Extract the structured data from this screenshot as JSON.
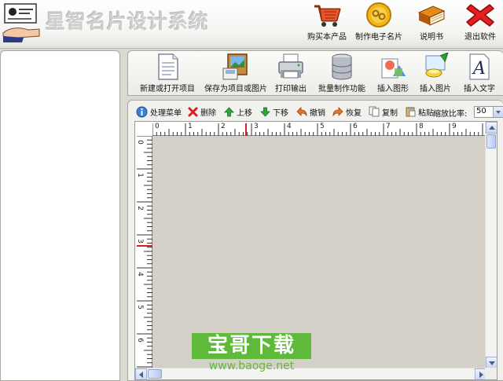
{
  "app": {
    "title": "星智名片设计系统"
  },
  "header": {
    "buttons": [
      {
        "label": "购买本产品",
        "icon": "shopping-cart-icon"
      },
      {
        "label": "制作电子名片",
        "icon": "gold-coin-icon"
      },
      {
        "label": "说明书",
        "icon": "book-icon"
      },
      {
        "label": "退出软件",
        "icon": "red-x-icon"
      }
    ]
  },
  "toolbar": {
    "buttons": [
      {
        "label": "新建或打开项目",
        "icon": "document-icon"
      },
      {
        "label": "保存为项目或图片",
        "icon": "save-picture-icon"
      },
      {
        "label": "打印输出",
        "icon": "printer-icon"
      },
      {
        "label": "批量制作功能",
        "icon": "database-icon"
      },
      {
        "label": "插入图形",
        "icon": "shapes-icon"
      },
      {
        "label": "插入图片",
        "icon": "paint-icon"
      },
      {
        "label": "插入文字",
        "icon": "text-a-icon"
      }
    ]
  },
  "edit_bar": {
    "items": [
      {
        "label": "处理菜单",
        "icon": "menu-globe-icon"
      },
      {
        "label": "删除",
        "icon": "delete-x-icon"
      },
      {
        "label": "上移",
        "icon": "up-arrow-icon"
      },
      {
        "label": "下移",
        "icon": "down-arrow-icon"
      },
      {
        "label": "撤销",
        "icon": "undo-icon"
      },
      {
        "label": "恢复",
        "icon": "redo-icon"
      },
      {
        "label": "复制",
        "icon": "copy-icon"
      },
      {
        "label": "粘贴",
        "icon": "paste-icon"
      }
    ],
    "zoom_label": "缩放比率:",
    "zoom_value": "50",
    "zoom_suffix": "%"
  },
  "rulers": {
    "horizontal": [
      "0",
      "1",
      "2",
      "3",
      "4",
      "5",
      "6",
      "7",
      "8",
      "9"
    ],
    "vertical": [
      "0",
      "1",
      "2",
      "3",
      "4",
      "5",
      "6"
    ]
  },
  "watermark": {
    "title": "宝哥下载",
    "url": "www.baoge.net"
  },
  "colors": {
    "canvas": "#d4d0c8",
    "watermark": "#5fba3b",
    "ruler_marker": "#d62020"
  }
}
